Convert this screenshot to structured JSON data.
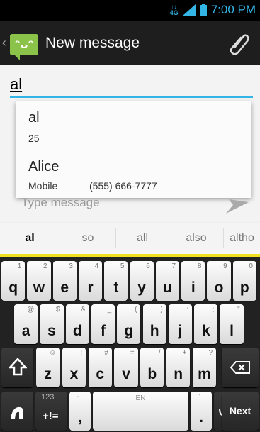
{
  "status": {
    "network": "4G",
    "time": "7:00 PM"
  },
  "actionbar": {
    "title": "New message",
    "app_icon": "messaging-smiley-icon",
    "attach_icon": "paperclip-icon"
  },
  "compose": {
    "to_value": "al",
    "suggestions": [
      {
        "name": "al",
        "type": "25",
        "number": ""
      },
      {
        "name": "Alice",
        "type": "Mobile",
        "number": "(555) 666-7777"
      }
    ],
    "message_placeholder": "Type message",
    "send_icon": "send-arrow-icon"
  },
  "keyboard": {
    "suggestions": [
      "al",
      "so",
      "all",
      "also",
      "altho"
    ],
    "row1": [
      {
        "k": "q",
        "a": "1"
      },
      {
        "k": "w",
        "a": "2"
      },
      {
        "k": "e",
        "a": "3"
      },
      {
        "k": "r",
        "a": "4"
      },
      {
        "k": "t",
        "a": "5"
      },
      {
        "k": "y",
        "a": "6"
      },
      {
        "k": "u",
        "a": "7"
      },
      {
        "k": "i",
        "a": "8"
      },
      {
        "k": "o",
        "a": "9"
      },
      {
        "k": "p",
        "a": "0"
      }
    ],
    "row2": [
      {
        "k": "a",
        "a": "@"
      },
      {
        "k": "s",
        "a": "$"
      },
      {
        "k": "d",
        "a": "&"
      },
      {
        "k": "f",
        "a": "_"
      },
      {
        "k": "g",
        "a": "("
      },
      {
        "k": "h",
        "a": ")"
      },
      {
        "k": "j",
        "a": ":"
      },
      {
        "k": "k",
        "a": ";"
      },
      {
        "k": "l",
        "a": "\""
      }
    ],
    "row3": [
      {
        "k": "z",
        "a": "☺"
      },
      {
        "k": "x",
        "a": "!"
      },
      {
        "k": "c",
        "a": "#"
      },
      {
        "k": "v",
        "a": "="
      },
      {
        "k": "b",
        "a": "/"
      },
      {
        "k": "n",
        "a": "+"
      },
      {
        "k": "m",
        "a": "?"
      }
    ],
    "symbols_label": "123",
    "symbols_sub": "+!=",
    "comma": ",",
    "comma_alt": "-",
    "space_label": "EN",
    "period": ".",
    "period_alt": "'",
    "next_label": "Next",
    "shift_icon": "shift-arrow-icon",
    "backspace_icon": "backspace-icon",
    "mic_icon": "microphone-icon",
    "swipe_icon": "swipe-gesture-icon"
  }
}
